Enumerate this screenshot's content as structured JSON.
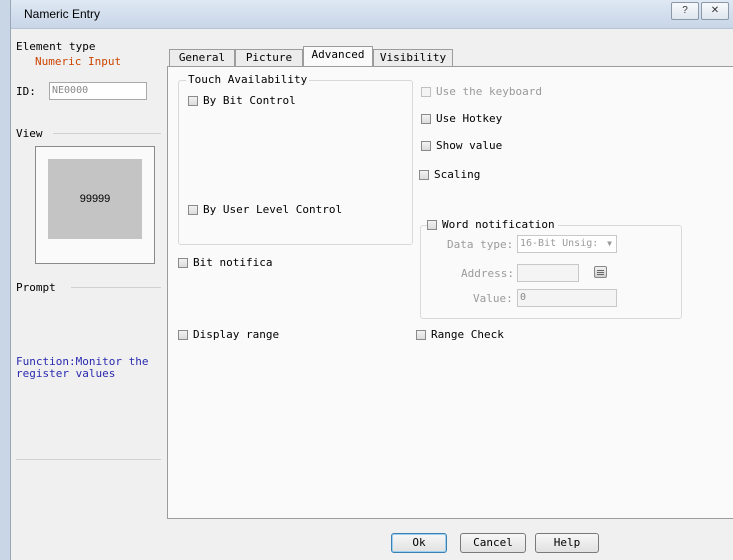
{
  "window": {
    "title": "Nameric Entry",
    "help_btn": "?",
    "close_btn": "✕"
  },
  "left": {
    "element_type_label": "Element type",
    "element_type_value": "Numeric Input",
    "id_label": "ID:",
    "id_value": "NE0000",
    "view_label": "View",
    "preview_value": "99999",
    "prompt_label": "Prompt",
    "prompt_text": "Function:Monitor the register values"
  },
  "tabs": [
    {
      "label": "General"
    },
    {
      "label": "Picture"
    },
    {
      "label": "Advanced"
    },
    {
      "label": "Visibility"
    }
  ],
  "advanced": {
    "touch_group_title": "Touch Availability",
    "by_bit_control": "By Bit Control",
    "by_user_level_control": "By User Level Control",
    "use_keyboard": "Use the keyboard",
    "use_hotkey": "Use Hotkey",
    "show_value": "Show value",
    "scaling": "Scaling",
    "word_notification": "Word notification",
    "data_type_label": "Data type:",
    "data_type_value": "16-Bit Unsig:",
    "address_label": "Address:",
    "address_value": "",
    "value_label": "Value:",
    "value_value": "0",
    "bit_notification": "Bit notifica",
    "display_range": "Display range",
    "range_check": "Range Check"
  },
  "buttons": {
    "ok": "Ok",
    "cancel": "Cancel",
    "help": "Help"
  },
  "colors": {
    "accent_orange": "#cc4400",
    "prompt_blue": "#2a2ab0",
    "preview_bg": "#c4c4c4"
  }
}
